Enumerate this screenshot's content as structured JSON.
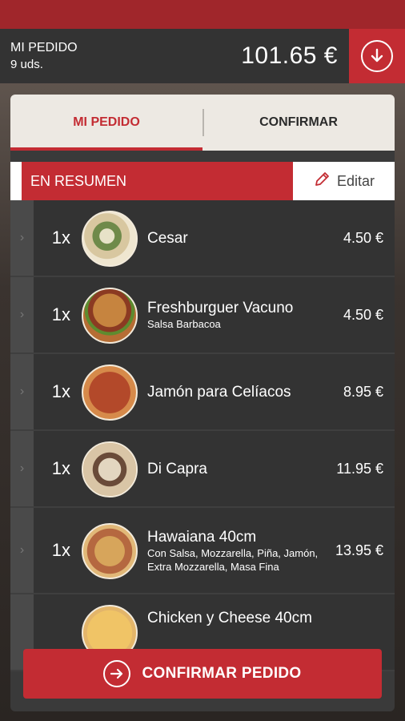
{
  "order": {
    "label": "MI PEDIDO",
    "count": "9 uds.",
    "total": "101.65 €"
  },
  "icons": {
    "download": "download-circle-icon",
    "edit": "pencil-icon",
    "arrow": "arrow-right-circle-icon",
    "chevron": "chevron-right-icon"
  },
  "tabs": [
    {
      "label": "MI PEDIDO"
    },
    {
      "label": "CONFIRMAR"
    }
  ],
  "summary": {
    "title": "EN RESUMEN",
    "edit_label": "Editar"
  },
  "items": [
    {
      "qty": "1x",
      "name": "Cesar",
      "desc": "",
      "price": "4.50 €"
    },
    {
      "qty": "1x",
      "name": "Freshburguer Vacuno",
      "desc": "Salsa Barbacoa",
      "price": "4.50 €"
    },
    {
      "qty": "1x",
      "name": "Jamón para Celíacos",
      "desc": "",
      "price": "8.95 €"
    },
    {
      "qty": "1x",
      "name": "Di Capra",
      "desc": "",
      "price": "11.95 €"
    },
    {
      "qty": "1x",
      "name": "Hawaiana 40cm",
      "desc": "Con Salsa, Mozzarella, Piña, Jamón, Extra Mozzarella, Masa Fina",
      "price": "13.95 €"
    },
    {
      "qty": "",
      "name": "Chicken y Cheese 40cm",
      "desc": "",
      "price": ""
    }
  ],
  "confirm_button": {
    "label": "CONFIRMAR PEDIDO"
  },
  "colors": {
    "accent": "#c32c33",
    "dark": "#333333",
    "tab_bg": "#ede9e3"
  }
}
